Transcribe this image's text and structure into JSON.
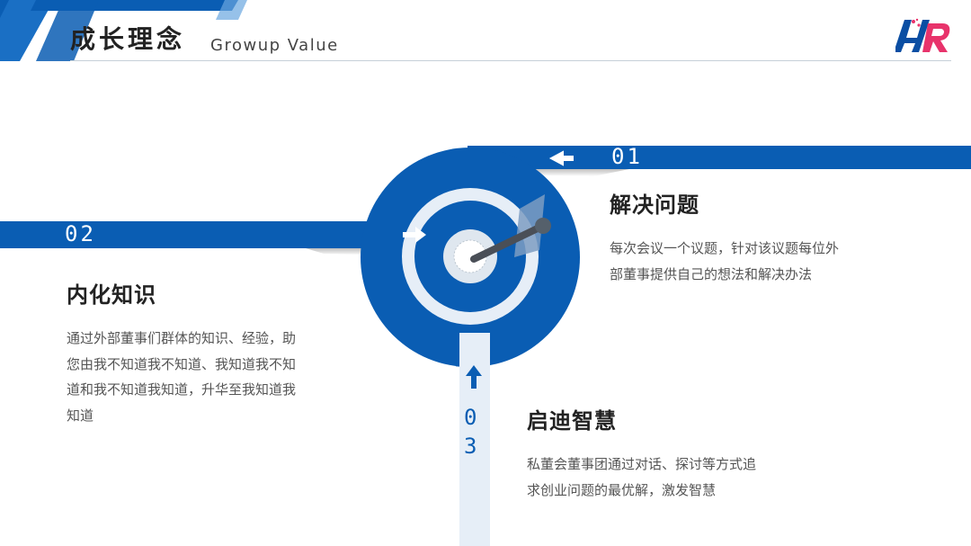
{
  "header": {
    "title": "成长理念",
    "subtitle": "Growup Value"
  },
  "colors": {
    "primary": "#0a5db3",
    "light": "#e6eef7",
    "accent_pink": "#e8336b"
  },
  "items": [
    {
      "number": "01",
      "title": "解决问题",
      "desc_lines": [
        "每次会议一个议题，针对该议题每位外",
        "部董事提供自己的想法和解决办法"
      ]
    },
    {
      "number": "02",
      "title": "内化知识",
      "desc_lines": [
        "通过外部董事们群体的知识、经验，助",
        "您由我不知道我不知道、我知道我不知",
        "道和我不知道我知道，升华至我知道我",
        "知道"
      ]
    },
    {
      "number_top": "0",
      "number_bottom": "3",
      "title": "启迪智慧",
      "desc_lines": [
        "私董会董事团通过对话、探讨等方式追",
        "求创业问题的最优解，激发智慧"
      ]
    }
  ]
}
